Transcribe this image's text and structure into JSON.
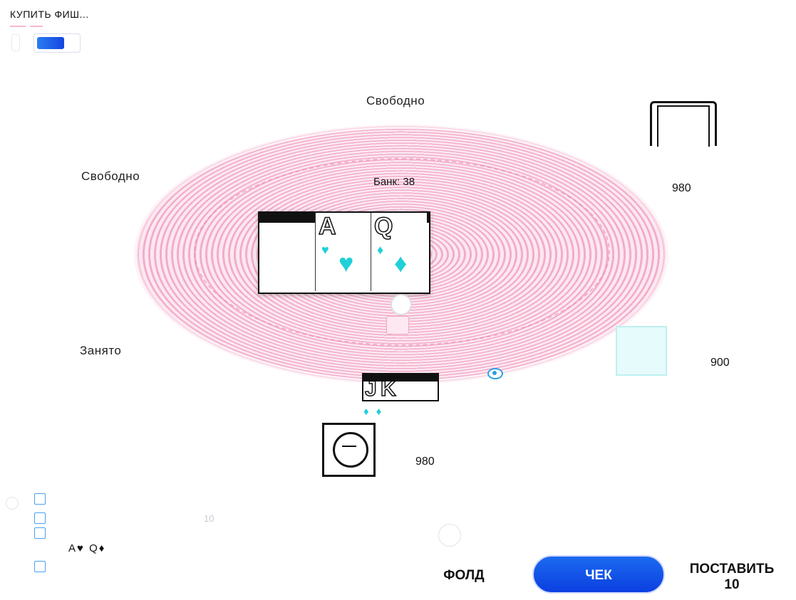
{
  "header": {
    "buy_chips_label": "КУПИТЬ ФИШ..."
  },
  "table": {
    "pot_label": "Банк: 38"
  },
  "seats": {
    "top": {
      "label": "Свободно"
    },
    "top_left": {
      "label": "Свободно"
    },
    "bottom_left": {
      "label": "Занято"
    },
    "top_right": {
      "stack": "980"
    },
    "right": {
      "stack": "900"
    },
    "hero": {
      "stack": "980"
    }
  },
  "board_cards": [
    {
      "rank": "A",
      "suit": "♥"
    },
    {
      "rank": "Q",
      "suit": "♦"
    }
  ],
  "hero_cards": [
    {
      "rank": "J",
      "suit": "♦"
    },
    {
      "rank": "K",
      "suit": "♦"
    }
  ],
  "history": {
    "revealed_cards": "A♥ Q♦",
    "amount": "10"
  },
  "actions": {
    "fold_label": "ФОЛД",
    "check_label": "ЧЕК",
    "bet_label": "ПОСТАВИТЬ",
    "bet_amount": "10"
  },
  "colors": {
    "table_felt": "#f7c6da",
    "accent": "#1c6af0",
    "suit": "#1fd0d8"
  }
}
